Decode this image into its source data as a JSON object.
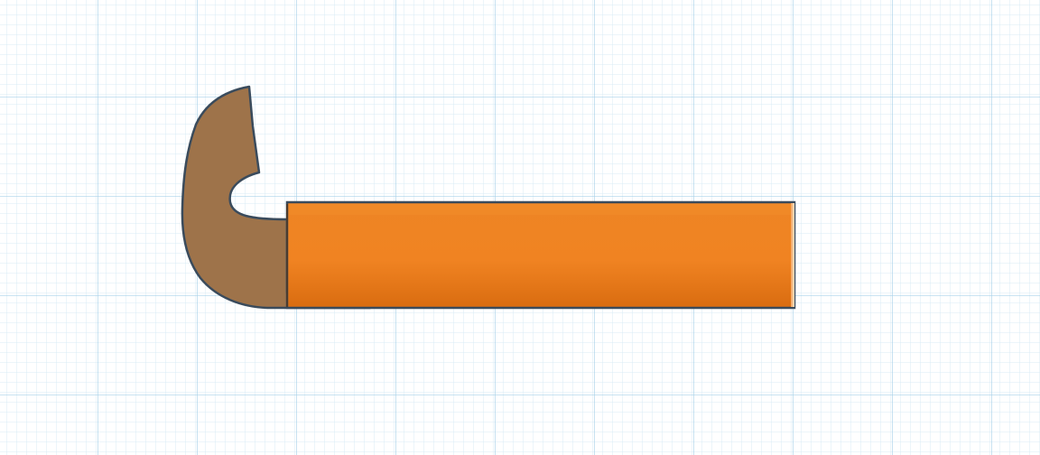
{
  "workplane": {
    "background_color": "#ffffff",
    "minor_grid_color": "#d9ebf5",
    "major_grid_color": "#a9d2e9"
  },
  "objects": [
    {
      "name": "hook",
      "color": "#9e734a",
      "outline_color": "#3a4b5c"
    },
    {
      "name": "cylinder",
      "color": "#ef8322",
      "highlight_color": "#f48b24",
      "shadow_color": "#d96d12",
      "outline_color": "#3a4b5c"
    }
  ]
}
